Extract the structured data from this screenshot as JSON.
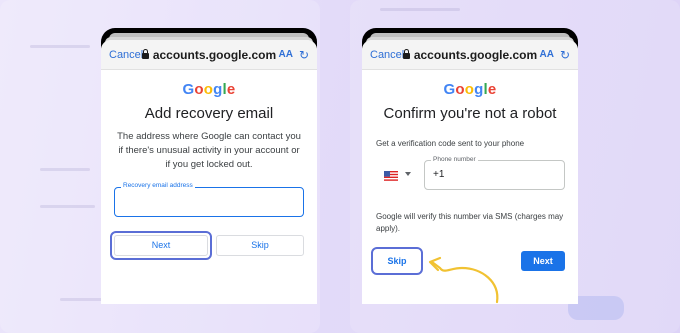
{
  "left_phone": {
    "cancel_label": "Cancel",
    "url": "accounts.google.com",
    "aa_label": "AA",
    "logo": "Google",
    "title": "Add recovery email",
    "description": "The address where Google can contact you if there's unusual activity in your account or if you get locked out.",
    "email_field_label": "Recovery email address",
    "email_field_value": "",
    "next_label": "Next",
    "skip_label": "Skip"
  },
  "right_phone": {
    "cancel_label": "Cancel",
    "url": "accounts.google.com",
    "aa_label": "AA",
    "logo": "Google",
    "title": "Confirm you're not a robot",
    "prompt": "Get a verification code sent to your phone",
    "phone_field_label": "Phone number",
    "phone_field_value": "+1",
    "country": "US",
    "sms_note": "Google will verify this number via SMS (charges may apply).",
    "skip_label": "Skip",
    "next_label": "Next"
  },
  "colors": {
    "accent_blue": "#1a73e8",
    "highlight": "#5b6ed6",
    "arrow": "#f1c232"
  },
  "icons": [
    "lock-icon",
    "text-size-icon",
    "reload-icon",
    "us-flag-icon",
    "chevron-down-icon",
    "curved-arrow-icon"
  ]
}
